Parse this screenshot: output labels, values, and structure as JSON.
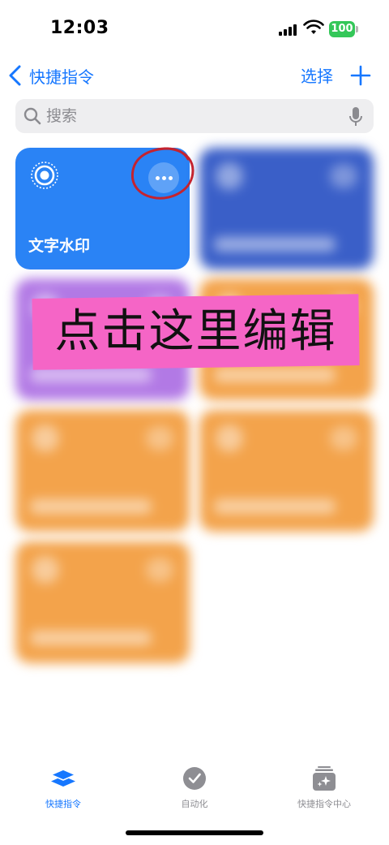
{
  "status_bar": {
    "time": "12:03",
    "battery": "100",
    "battery_color": "#34c759",
    "icons": [
      "signal-icon",
      "wifi-icon"
    ]
  },
  "nav": {
    "back_label": "快捷指令",
    "title": "",
    "select_label": "选择",
    "add_icon": "plus-icon"
  },
  "search": {
    "placeholder": "搜索",
    "value": ""
  },
  "cards": [
    {
      "title": "文字水印",
      "color": "#2a83f5",
      "icon": "watermark-target-icon",
      "blurred": false
    },
    {
      "title": "",
      "color": "#3a5fc8",
      "blurred": true
    },
    {
      "title": "",
      "color": "#b279e5",
      "blurred": true
    },
    {
      "title": "",
      "color": "#f3a34b",
      "blurred": true
    },
    {
      "title": "",
      "color": "#f3a34b",
      "blurred": true
    },
    {
      "title": "",
      "color": "#f3a34b",
      "blurred": true
    },
    {
      "title": "",
      "color": "#f3a34b",
      "blurred": true
    }
  ],
  "annotation": {
    "text": "点击这里编辑",
    "banner_color": "#f565c6",
    "circle_color": "#c4232f"
  },
  "tab_bar": {
    "tabs": [
      {
        "label": "快捷指令",
        "icon": "layers-icon",
        "active": true
      },
      {
        "label": "自动化",
        "icon": "clock-check-icon",
        "active": false
      },
      {
        "label": "快捷指令中心",
        "icon": "gallery-sparkle-icon",
        "active": false
      }
    ],
    "accent": "#1677ff"
  }
}
